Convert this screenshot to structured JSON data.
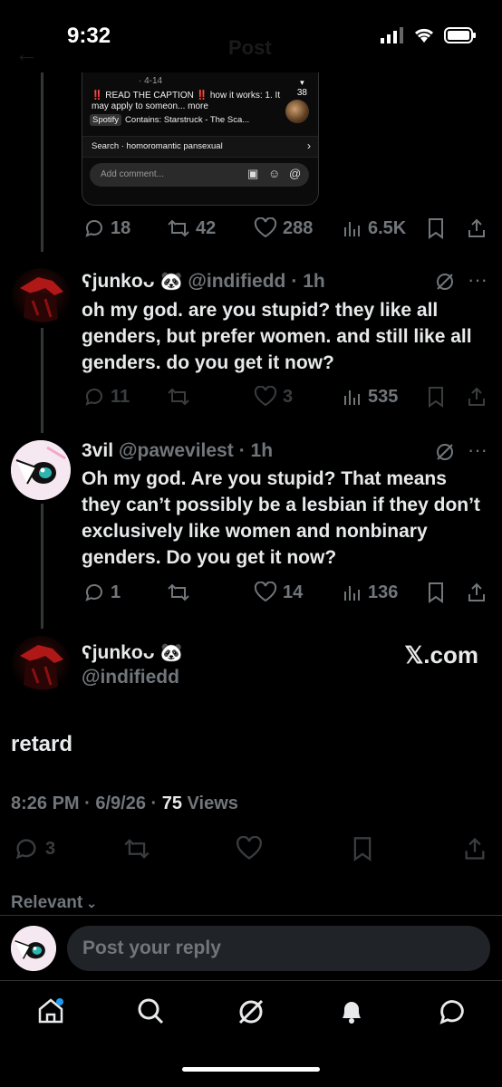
{
  "status": {
    "time": "9:32"
  },
  "header": {
    "back": "←",
    "title": "Post"
  },
  "embed": {
    "date": "· 4-14",
    "count": "38",
    "caption_prefix": "‼️",
    "caption_main": " READ THE CAPTION ",
    "caption_mid": "‼️",
    "caption_rest": " how it works: 1. It may apply to someon... more",
    "music_tag": "Spotify",
    "music_text": "Contains: Starstruck - The Sca...",
    "search_text": "Search · homoromantic pansexual",
    "comment_placeholder": "Add comment..."
  },
  "post0_actions": {
    "replies": "18",
    "reposts": "42",
    "likes": "288",
    "views": "6.5K"
  },
  "reply1": {
    "name": "junko",
    "handle": "@indifiedd",
    "time": "· 1h",
    "text": "oh my god. are you stupid? they like all genders, but prefer women. and still like all genders. do you get it now?",
    "replies": "11",
    "likes": "3",
    "views": "535"
  },
  "reply2": {
    "name": "3vil",
    "handle": "@pawevilest",
    "time": "· 1h",
    "text": "Oh my god. Are you stupid? That means they can’t possibly be a lesbian if they don’t exclusively like women and nonbinary genders. Do you get it now?",
    "replies": "1",
    "likes": "14",
    "views": "136"
  },
  "main": {
    "name": "junko",
    "handle": "@indifiedd",
    "watermark": "𝕏.com",
    "text": "retard",
    "meta_time": "8:26 PM · 6/9/26 · ",
    "meta_views": "75",
    "meta_views_label": " Views",
    "replies": "3"
  },
  "sort": {
    "label": "Relevant"
  },
  "reply_bar": {
    "placeholder": "Post your reply"
  },
  "colors": {
    "background": "#000000",
    "text": "#e7e9ea",
    "muted": "#71767b",
    "notification_dot": "#1d9bf0"
  }
}
